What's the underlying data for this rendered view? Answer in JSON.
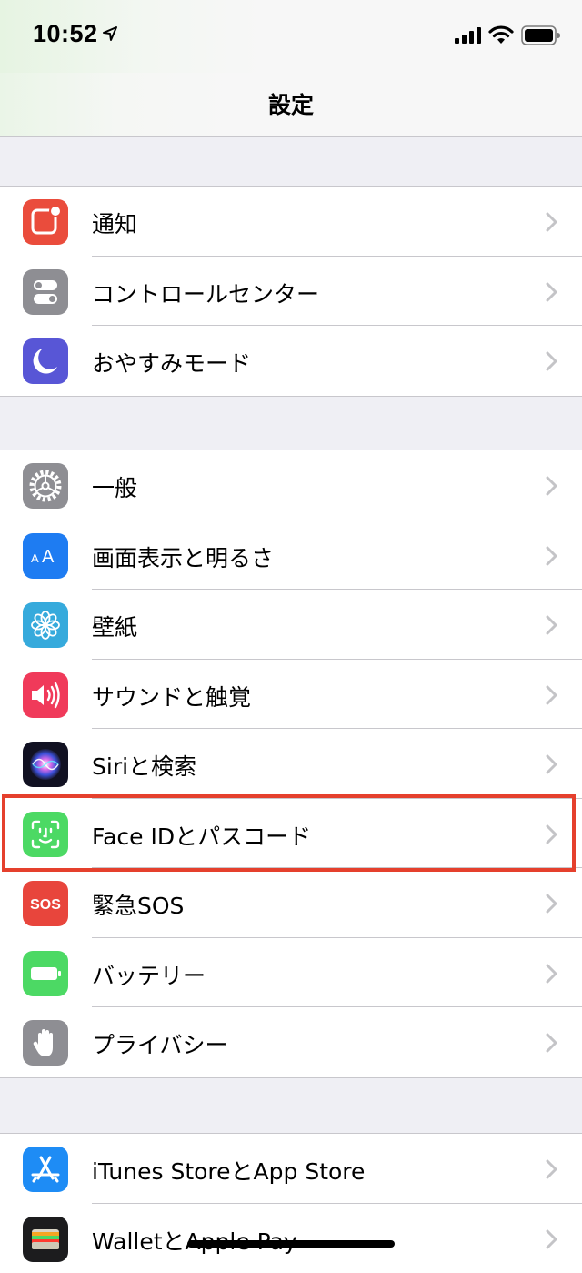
{
  "status_bar": {
    "time": "10:52",
    "icons": [
      "location-arrow-icon",
      "cellular-signal-icon",
      "wifi-icon",
      "battery-icon"
    ]
  },
  "nav": {
    "title": "設定"
  },
  "groups": [
    {
      "rows": [
        {
          "label": "通知",
          "icon": "notifications-icon",
          "color": "#ea4c3c"
        },
        {
          "label": "コントロールセンター",
          "icon": "control-center-icon",
          "color": "#8e8e93"
        },
        {
          "label": "おやすみモード",
          "icon": "do-not-disturb-moon-icon",
          "color": "#5856d6"
        }
      ]
    },
    {
      "rows": [
        {
          "label": "一般",
          "icon": "general-gear-icon",
          "color": "#8e8e93"
        },
        {
          "label": "画面表示と明るさ",
          "icon": "display-brightness-icon",
          "color": "#1e7cf2"
        },
        {
          "label": "壁紙",
          "icon": "wallpaper-flower-icon",
          "color": "#36aadc"
        },
        {
          "label": "サウンドと触覚",
          "icon": "sounds-speaker-icon",
          "color": "#f03a5a"
        },
        {
          "label": "Siriと検索",
          "icon": "siri-icon",
          "color": "#1a1a2e"
        },
        {
          "label": "Face IDとパスコード",
          "icon": "face-id-icon",
          "color": "#4cd964"
        },
        {
          "label": "緊急SOS",
          "icon": "emergency-sos-icon",
          "color": "#e8453c"
        },
        {
          "label": "バッテリー",
          "icon": "battery-settings-icon",
          "color": "#4cd964"
        },
        {
          "label": "プライバシー",
          "icon": "privacy-hand-icon",
          "color": "#8e8e93"
        }
      ]
    },
    {
      "rows": [
        {
          "label": "iTunes StoreとApp Store",
          "icon": "app-store-icon",
          "color": "#1e8cf5"
        },
        {
          "label": "WalletとApple Pay",
          "icon": "wallet-icon",
          "color": "#1c1c1e"
        }
      ]
    }
  ],
  "highlight": {
    "target": "Face IDとパスコード",
    "color": "#e5402d"
  }
}
